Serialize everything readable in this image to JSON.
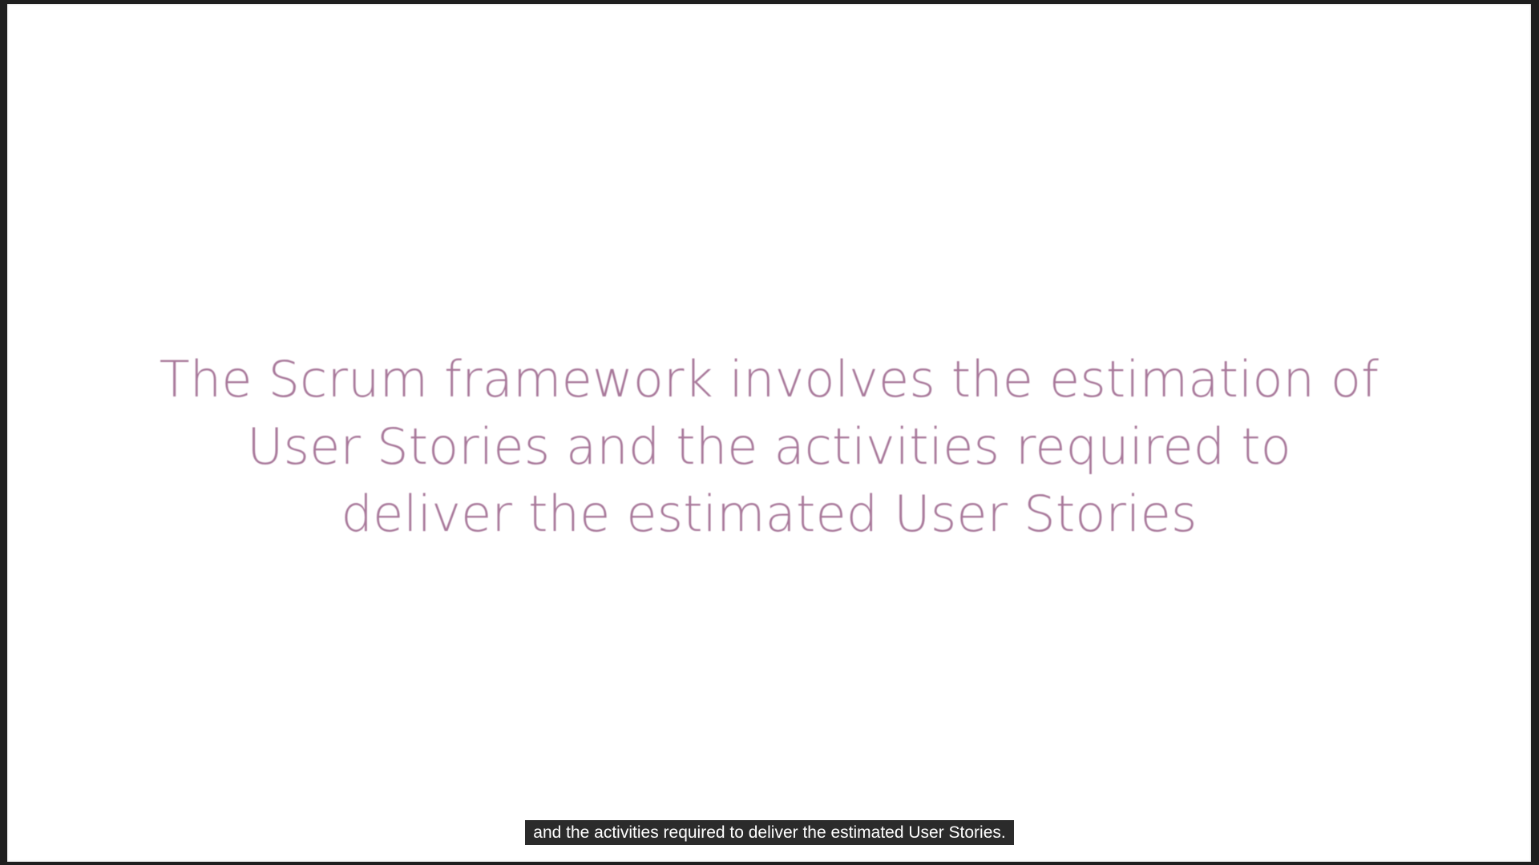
{
  "slide": {
    "lines": [
      "The Scrum framework involves the estimation of",
      "User Stories and the activities required to",
      "deliver the estimated User Stories"
    ],
    "text_color": "#a8789a",
    "background_color": "#ffffff"
  },
  "caption": {
    "text": "and the activities required to deliver the estimated User Stories."
  }
}
